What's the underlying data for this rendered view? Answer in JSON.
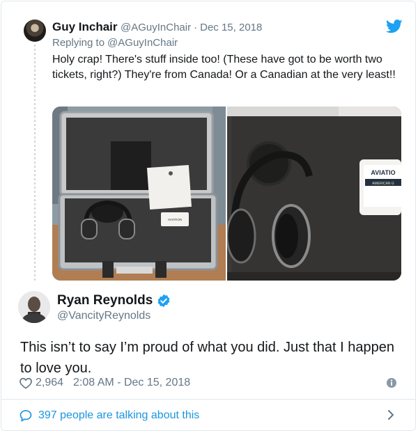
{
  "quoted": {
    "name": "Guy Inchair",
    "handle": "@AGuyInChair",
    "separator": "·",
    "date": "Dec 15, 2018",
    "reply_prefix": "Replying to",
    "reply_handle": "@AGuyInChair",
    "text": "Holy crap! There's stuff inside too! (These have got to be worth two tickets, right?) They're from Canada! Or a Canadian at the very least!!",
    "photo_labels": {
      "left_card": "AVIATION",
      "right_card_1": "AVIATIO",
      "right_card_2": "AMERICAN G"
    }
  },
  "tweet": {
    "name": "Ryan Reynolds",
    "handle": "@VancityReynolds",
    "text": "This isn’t to say I’m proud of what you did. Just that I happen to love you.",
    "likes": "2,964",
    "timestamp": "2:08 AM - Dec 15, 2018"
  },
  "footer": {
    "talking": "397 people are talking about this"
  },
  "colors": {
    "twitter_blue": "#1da1f2",
    "link_blue": "#1b95e0",
    "secondary_text": "#657786",
    "border": "#e1e8ed"
  },
  "icons": [
    "twitter-bird-icon",
    "verified-badge-icon",
    "heart-icon",
    "info-icon",
    "speech-bubble-icon",
    "chevron-right-icon"
  ]
}
